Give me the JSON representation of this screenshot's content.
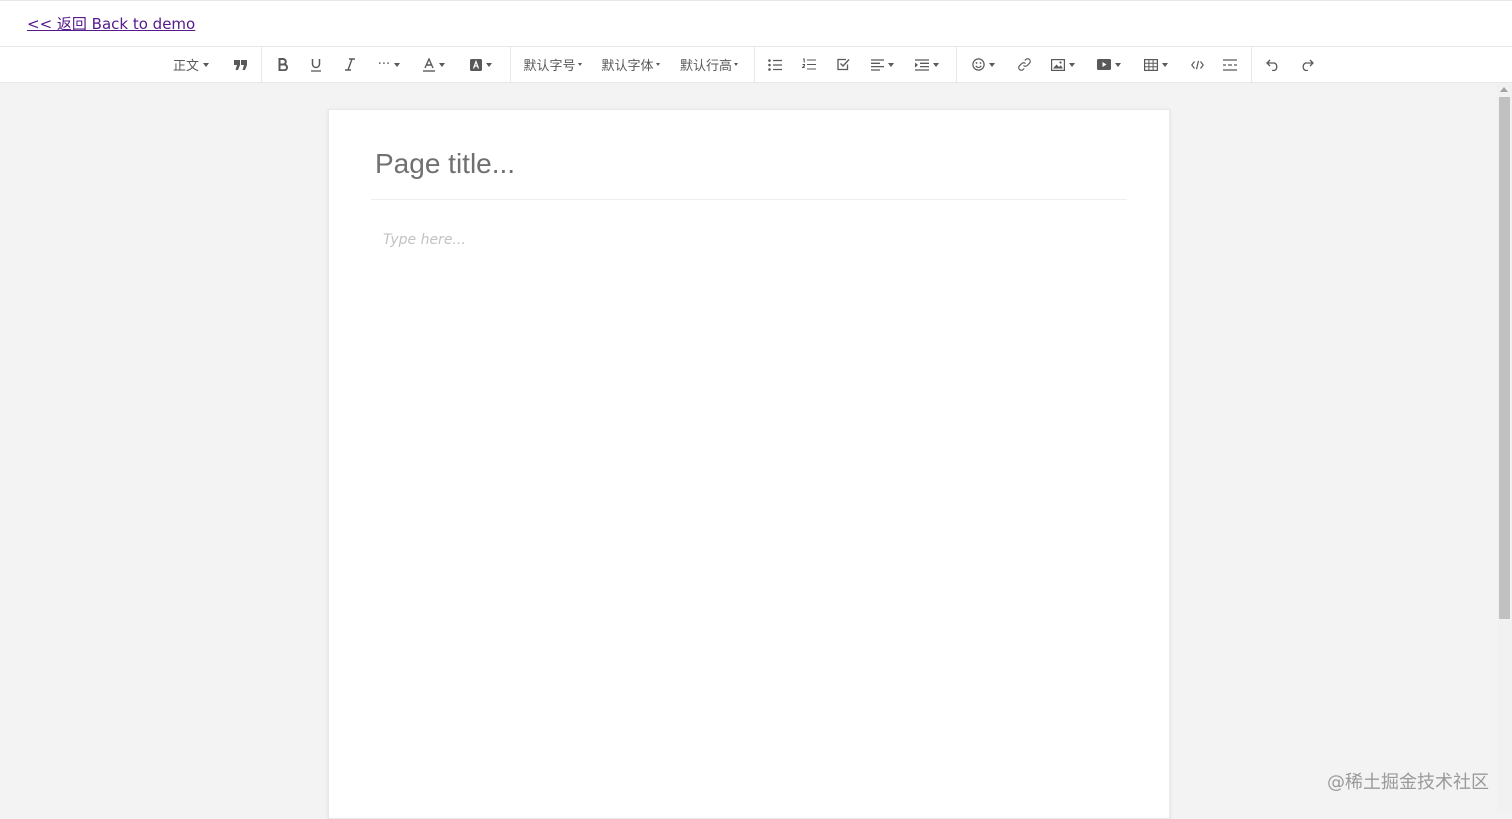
{
  "nav": {
    "back_label": "<< 返回 Back to demo"
  },
  "toolbar": {
    "header_label": "正文",
    "font_size_label": "默认字号",
    "font_family_label": "默认字体",
    "line_height_label": "默认行高",
    "more_label": "···",
    "icons": [
      "quote-icon",
      "bold-icon",
      "underline-icon",
      "italic-icon",
      "font-color-icon",
      "background-color-icon",
      "bulleted-list-icon",
      "numbered-list-icon",
      "todo-icon",
      "justify-icon",
      "indent-icon",
      "emotion-icon",
      "link-icon",
      "image-icon",
      "video-icon",
      "table-icon",
      "code-block-icon",
      "divider-icon",
      "undo-icon",
      "redo-icon"
    ]
  },
  "editor": {
    "title_placeholder": "Page title...",
    "body_placeholder": "Type here..."
  },
  "watermark": "@稀土掘金技术社区",
  "colors": {
    "background": "#f3f3f3",
    "page": "#ffffff",
    "link": "#551a8b",
    "icon": "#595959"
  }
}
